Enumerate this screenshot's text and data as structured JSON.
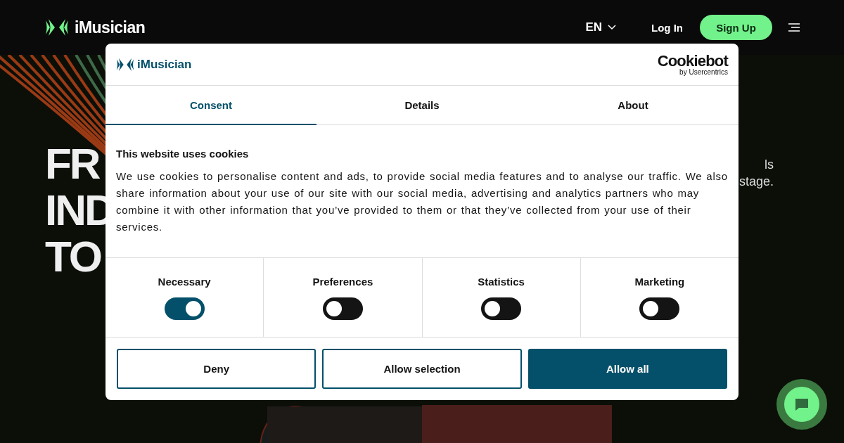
{
  "header": {
    "logo": "iMusician",
    "language": "EN",
    "login": "Log In",
    "signup": "Sign Up"
  },
  "hero": {
    "title_lines": [
      "FR",
      "IND",
      "TO"
    ],
    "side_lines": [
      "ls",
      "stage."
    ]
  },
  "consent_dialog": {
    "logo": "iMusician",
    "provider": "Cookiebot",
    "provider_sub": "by Usercentrics",
    "tabs": [
      {
        "label": "Consent",
        "selected": true
      },
      {
        "label": "Details",
        "selected": false
      },
      {
        "label": "About",
        "selected": false
      }
    ],
    "heading": "This website uses cookies",
    "body": "We use cookies to personalise content and ads, to provide social media features and to analyse our traffic. We also share information about your use of our site with our social media, advertising and analytics partners who may combine it with other information that you’ve provided to them or that they’ve collected from your use of their services.",
    "categories": [
      {
        "label": "Necessary",
        "on": true
      },
      {
        "label": "Preferences",
        "on": false
      },
      {
        "label": "Statistics",
        "on": false
      },
      {
        "label": "Marketing",
        "on": false
      }
    ],
    "buttons": [
      {
        "label": "Deny",
        "kind": "outline"
      },
      {
        "label": "Allow selection",
        "kind": "outline"
      },
      {
        "label": "Allow all",
        "kind": "primary"
      }
    ]
  }
}
